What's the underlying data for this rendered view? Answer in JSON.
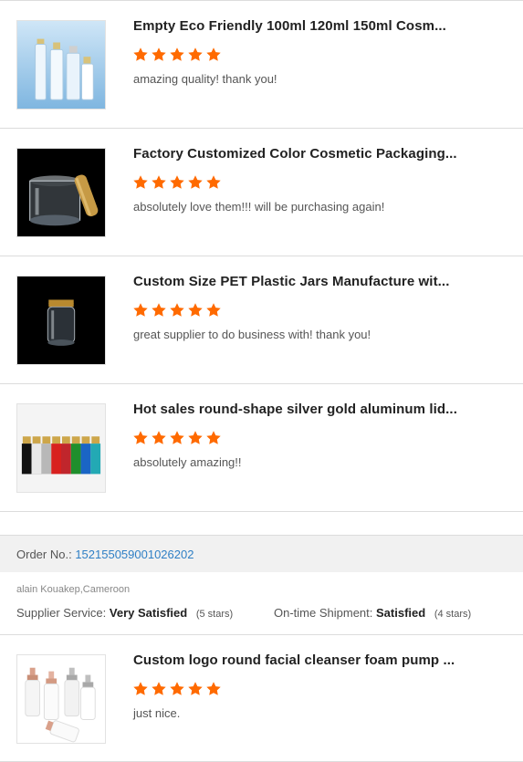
{
  "reviews": [
    {
      "title": "Empty Eco Friendly 100ml 120ml 150ml Cosm...",
      "rating": 5,
      "comment": "amazing quality! thank you!",
      "thumb_icon": "clear-bottles-image"
    },
    {
      "title": "Factory Customized Color Cosmetic Packaging...",
      "rating": 5,
      "comment": "absolutely love them!!! will be purchasing again!",
      "thumb_icon": "clear-jar-gold-lid-image"
    },
    {
      "title": "Custom Size PET Plastic Jars Manufacture wit...",
      "rating": 5,
      "comment": "great supplier to do business with! thank you!",
      "thumb_icon": "pet-jar-image"
    },
    {
      "title": "Hot sales round-shape silver gold aluminum lid...",
      "rating": 5,
      "comment": "absolutely amazing!!",
      "thumb_icon": "colored-bottles-image"
    }
  ],
  "order": {
    "label": "Order No.:",
    "number": "152155059001026202"
  },
  "feedback": {
    "buyer": "alain Kouakep,Cameroon",
    "supplier_label": "Supplier Service:",
    "supplier_value": "Very Satisfied",
    "supplier_stars": "(5 stars)",
    "shipment_label": "On-time Shipment:",
    "shipment_value": "Satisfied",
    "shipment_stars": "(4 stars)"
  },
  "last_review": {
    "title": "Custom logo round facial cleanser foam pump ...",
    "rating": 5,
    "comment": "just nice.",
    "thumb_icon": "foam-pump-bottles-image"
  },
  "colors": {
    "star": "#ff6a00",
    "link": "#2f7fc5",
    "divider": "#dcdcdc",
    "order_bar_bg": "#f1f1f1"
  }
}
